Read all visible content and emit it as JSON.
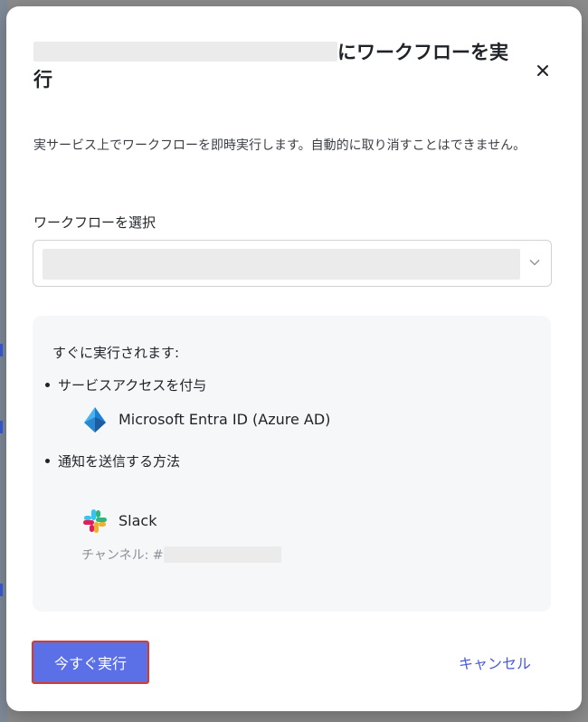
{
  "modal": {
    "title_suffix": "にワークフローを実行",
    "description": "実サービス上でワークフローを即時実行します。自動的に取り消すことはできません。",
    "workflow_label": "ワークフローを選択",
    "info": {
      "heading": "すぐに実行されます:",
      "access_label": "サービスアクセスを付与",
      "access_service": "Microsoft Entra ID (Azure AD)",
      "notify_label": "通知を送信する方法",
      "notify_service": "Slack",
      "channel_prefix": "チャンネル: #"
    },
    "run_now_label": "今すぐ実行",
    "cancel_label": "キャンセル"
  },
  "icons": {
    "close": "close-icon",
    "chevron": "chevron-down-icon",
    "entra": "microsoft-entra-icon",
    "slack": "slack-icon"
  },
  "colors": {
    "primary": "#5b6fe6",
    "primary_outline": "#d93b2b",
    "link": "#4a5bd8"
  }
}
